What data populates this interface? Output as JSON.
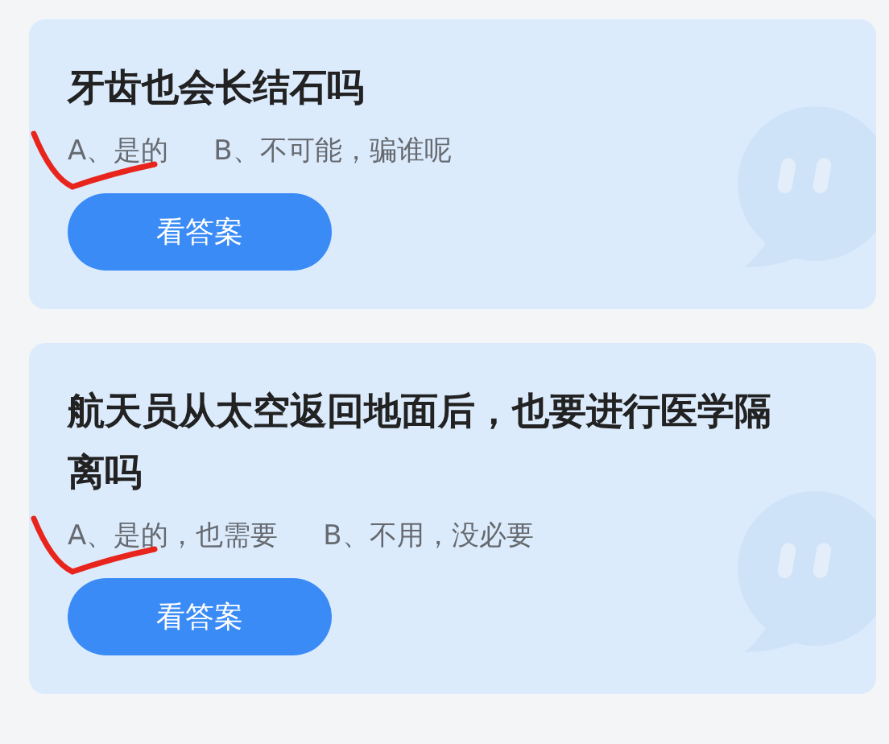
{
  "questions": [
    {
      "title": "牙齿也会长结石吗",
      "options": [
        {
          "text": "A、是的",
          "selected": true
        },
        {
          "text": "B、不可能，骗谁呢",
          "selected": false
        }
      ],
      "button": "看答案"
    },
    {
      "title": "航天员从太空返回地面后，也要进行医学隔离吗",
      "options": [
        {
          "text": "A、是的，也需要",
          "selected": true
        },
        {
          "text": "B、不用，没必要",
          "selected": false
        }
      ],
      "button": "看答案"
    }
  ]
}
